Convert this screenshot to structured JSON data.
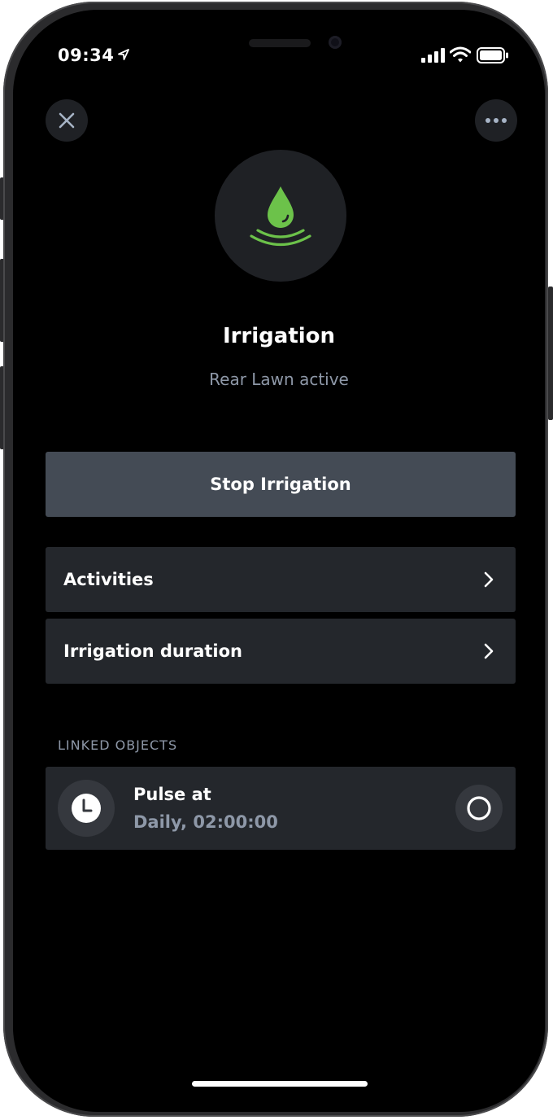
{
  "status_bar": {
    "time": "09:34",
    "icons": [
      "location-arrow-icon",
      "cellular-signal-icon",
      "wifi-icon",
      "battery-icon"
    ]
  },
  "header": {
    "close_icon": "close-icon",
    "more_icon": "more-horizontal-icon"
  },
  "hero": {
    "icon": "water-drop-icon",
    "icon_color": "#6cc24a",
    "title": "Irrigation",
    "subtitle": "Rear Lawn active"
  },
  "actions": {
    "primary_label": "Stop Irrigation"
  },
  "list": {
    "items": [
      {
        "label": "Activities"
      },
      {
        "label": "Irrigation duration"
      }
    ]
  },
  "linked_objects": {
    "section_label": "LINKED OBJECTS",
    "items": [
      {
        "icon": "clock-icon",
        "title": "Pulse at",
        "subtitle": "Daily, 02:00:00",
        "toggle_icon": "circle-toggle-icon"
      }
    ]
  },
  "colors": {
    "background": "#000000",
    "card": "#24272c",
    "button": "#444b55",
    "accent_green": "#6cc24a",
    "muted_text": "#8e98a8"
  }
}
